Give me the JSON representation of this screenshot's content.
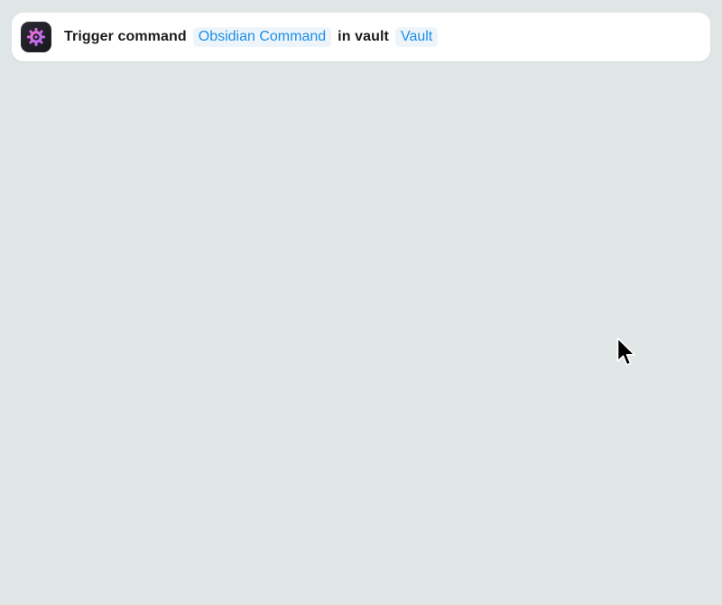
{
  "action": {
    "icon": "obsidian-gear-icon",
    "prefix": "Trigger command",
    "command_param": "Obsidian Command",
    "middle": "in vault",
    "vault_param": "Vault"
  },
  "colors": {
    "background": "#e0e6e6",
    "card": "#ffffff",
    "token_text": "#1d8ee6",
    "token_bg": "#edf5fb",
    "icon_gradient_start": "#ff6ec7",
    "icon_gradient_end": "#9a6bff"
  },
  "cursor": {
    "icon": "mouse-pointer-icon"
  }
}
